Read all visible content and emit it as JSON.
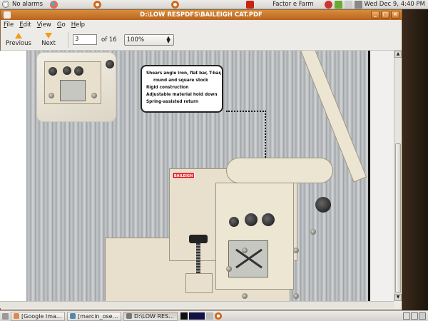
{
  "top_panel": {
    "alarm_label": "No alarms",
    "user_name": "Factor e Farm",
    "datetime": "Wed Dec  9,  4:40 PM"
  },
  "window": {
    "title": "D:\\LOW RESPDFS\\BAILEIGH CAT.PDF"
  },
  "menu": {
    "items": [
      "File",
      "Edit",
      "View",
      "Go",
      "Help"
    ]
  },
  "toolbar": {
    "previous_label": "Previous",
    "next_label": "Next",
    "page_value": "3",
    "page_total_label": "of 16",
    "zoom_value": "100%"
  },
  "document": {
    "callout_lines": [
      "Shears angle iron, flat bar, T-bar,",
      "round and square stock",
      "Rigid construction",
      "Adjustable material hold down",
      "Spring-assisted return"
    ],
    "brand": "BAILEIGH"
  },
  "taskbar": {
    "tasks": [
      "[Google Ima...",
      "[marcin_ose...",
      "D:\\LOW RES..."
    ]
  },
  "colors": {
    "titlebar": "#c8762a",
    "accent": "#f39c12",
    "machine": "#e8e0cc"
  }
}
